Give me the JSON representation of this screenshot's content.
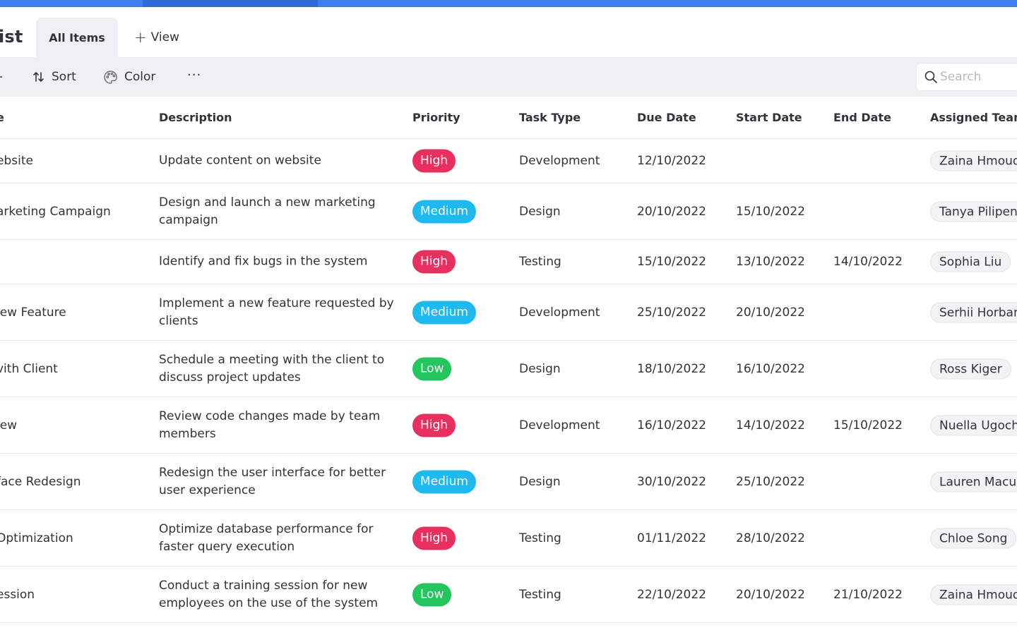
{
  "header": {
    "title": "ist",
    "tab_active": "All Items",
    "tab_add_view": "View"
  },
  "toolbar": {
    "sort_label": "Sort",
    "color_label": "Color",
    "more_label": "···",
    "search_placeholder": "Search"
  },
  "colors": {
    "accent": "#3d7ff0",
    "high": "#e8305f",
    "medium": "#1eb9ee",
    "low": "#22c55e"
  },
  "table": {
    "columns": [
      "e",
      "Description",
      "Priority",
      "Task Type",
      "Due Date",
      "Start Date",
      "End Date",
      "Assigned Tean"
    ],
    "rows": [
      {
        "name": "ebsite",
        "description": "Update content on website",
        "priority": "High",
        "task_type": "Development",
        "due": "12/10/2022",
        "start": "",
        "end": "",
        "team": "Zaina Hmoud"
      },
      {
        "name": "arketing Campaign",
        "description": "Design and launch a new marketing campaign",
        "priority": "Medium",
        "task_type": "Design",
        "due": "20/10/2022",
        "start": "15/10/2022",
        "end": "",
        "team": "Tanya Pilipen"
      },
      {
        "name": "",
        "description": "Identify and fix bugs in the system",
        "priority": "High",
        "task_type": "Testing",
        "due": "15/10/2022",
        "start": "13/10/2022",
        "end": "14/10/2022",
        "team": "Sophia Liu"
      },
      {
        "name": "lew Feature",
        "description": "Implement a new feature requested by clients",
        "priority": "Medium",
        "task_type": "Development",
        "due": "25/10/2022",
        "start": "20/10/2022",
        "end": "",
        "team": "Serhii Horban"
      },
      {
        "name": "vith Client",
        "description": "Schedule a meeting with the client to discuss project updates",
        "priority": "Low",
        "task_type": "Design",
        "due": "18/10/2022",
        "start": "16/10/2022",
        "end": "",
        "team": "Ross Kiger"
      },
      {
        "name": "iew",
        "description": "Review code changes made by team members",
        "priority": "High",
        "task_type": "Development",
        "due": "16/10/2022",
        "start": "14/10/2022",
        "end": "15/10/2022",
        "team": "Nuella Ugoch"
      },
      {
        "name": "face Redesign",
        "description": "Redesign the user interface for better user experience",
        "priority": "Medium",
        "task_type": "Design",
        "due": "30/10/2022",
        "start": "25/10/2022",
        "end": "",
        "team": "Lauren Macul"
      },
      {
        "name": " Optimization",
        "description": "Optimize database performance for faster query execution",
        "priority": "High",
        "task_type": "Testing",
        "due": "01/11/2022",
        "start": "28/10/2022",
        "end": "",
        "team": "Chloe Song"
      },
      {
        "name": "ession",
        "description": "Conduct a training session for new employees on the use of the system",
        "priority": "Low",
        "task_type": "Testing",
        "due": "22/10/2022",
        "start": "20/10/2022",
        "end": "21/10/2022",
        "team": "Zaina Hmoud"
      }
    ]
  }
}
